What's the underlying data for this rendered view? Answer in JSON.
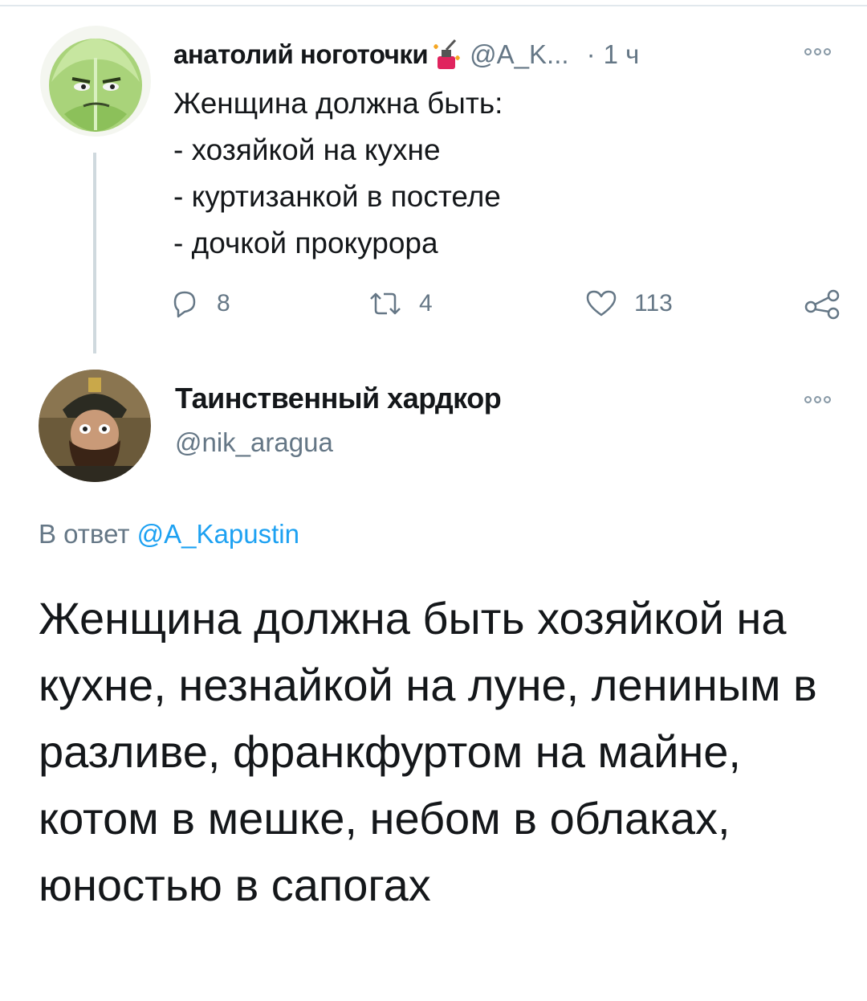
{
  "tweet1": {
    "author_name": "анатолий ноготочки",
    "handle": "@A_K...",
    "separator": "·",
    "time": "1 ч",
    "text": "Женщина должна быть:\n- хозяйкой на кухне\n- куртизанкой в постеле\n- дочкой прокурора",
    "reply_count": "8",
    "retweet_count": "4",
    "like_count": "113",
    "avatar_icon": "cabbage-avatar",
    "emoji_icon": "nail-polish-emoji"
  },
  "tweet2": {
    "author_name": "Таинственный хардкор",
    "handle": "@nik_aragua",
    "reply_prefix": "В ответ",
    "reply_mention": "@A_Kapustin",
    "text": "Женщина должна быть хозяйкой на кухне, незнайкой на луне, лениным в разливе, франкфуртом на майне, котом в мешке, небом в облаках, юностью в сапогах",
    "avatar_icon": "bearded-man-avatar"
  },
  "icons": {
    "reply": "reply-icon",
    "retweet": "retweet-icon",
    "like": "heart-icon",
    "share": "share-icon",
    "more": "more-options-icon"
  },
  "colors": {
    "text_primary": "#14171a",
    "text_secondary": "#657786",
    "link": "#1da1f2",
    "divider": "#e1e8ed"
  }
}
